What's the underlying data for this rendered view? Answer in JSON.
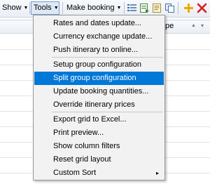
{
  "toolbar": {
    "show_label": "Show",
    "tools_label": "Tools",
    "make_booking_label": "Make booking",
    "dropdown_arrow": "▼",
    "icons": [
      "list-icon",
      "export-icon",
      "report-icon",
      "copy-icon",
      "add-icon",
      "delete-icon"
    ]
  },
  "grid": {
    "partial_header": "pe",
    "sort_glyph": "▲",
    "filter_glyph": "▾"
  },
  "tools_menu": {
    "groups": [
      [
        "Rates and dates update...",
        "Currency exchange update...",
        "Push itinerary to online..."
      ],
      [
        "Setup group configuration",
        "Split group configuration",
        "Update booking quantities...",
        "Override itinerary prices"
      ],
      [
        "Export grid to Excel...",
        "Print preview...",
        "Show column filters",
        "Reset grid layout",
        "Custom Sort"
      ]
    ],
    "highlighted_item": "Split group configuration",
    "submenu_item": "Custom Sort",
    "submenu_arrow": "▸"
  },
  "colors": {
    "highlight": "#0078d7",
    "menu_background": "#f2f2f2",
    "add_icon": "#f0a800",
    "delete_icon": "#d81e1e"
  }
}
